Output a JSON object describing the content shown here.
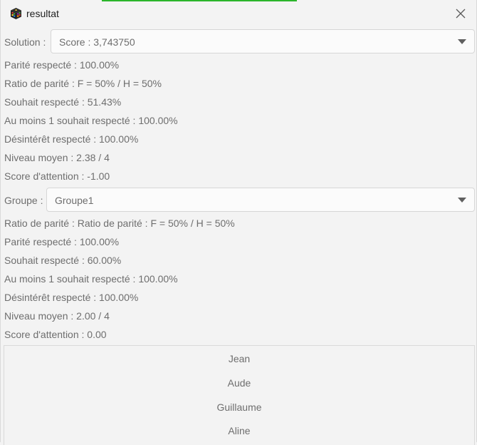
{
  "window": {
    "title": "resultat",
    "accent_color": "#2bb52b",
    "close_icon": "close-icon",
    "app_icon": "cube-app-icon"
  },
  "solution": {
    "label": "Solution :",
    "selected": "Score : 3,743750",
    "stats": [
      "Parité respecté : 100.00%",
      "Ratio de parité : F = 50% / H = 50%",
      "Souhait respecté : 51.43%",
      "Au moins 1 souhait respecté : 100.00%",
      "Désintérêt respecté : 100.00%",
      "Niveau moyen : 2.38 / 4",
      "Score d'attention : -1.00"
    ]
  },
  "group": {
    "label": "Groupe :",
    "selected": "Groupe1",
    "stats": [
      "Ratio de parité : Ratio de parité : F = 50% / H = 50%",
      "Parité respecté : 100.00%",
      "Souhait respecté : 60.00%",
      "Au moins 1 souhait respecté : 100.00%",
      "Désintérêt respecté : 100.00%",
      "Niveau moyen : 2.00 / 4",
      "Score d'attention : 0.00"
    ]
  },
  "members": [
    "Jean",
    "Aude",
    "Guillaume",
    "Aline"
  ]
}
